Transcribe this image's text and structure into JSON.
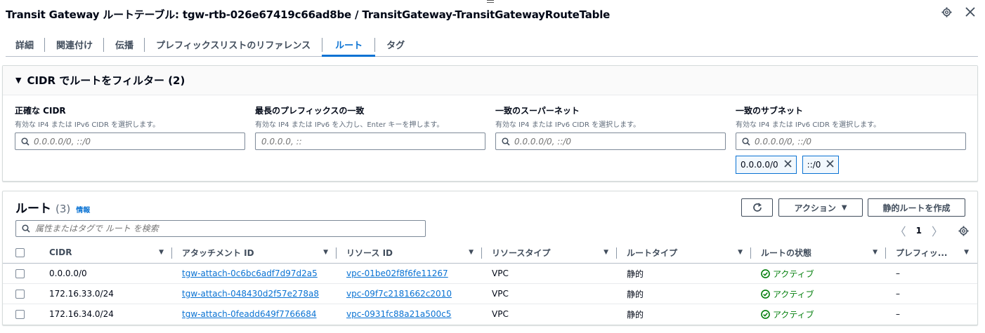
{
  "header": {
    "title": "Transit Gateway ルートテーブル: tgw-rtb-026e67419c66ad8be / TransitGateway-TransitGatewayRouteTable"
  },
  "tabs": [
    {
      "label": "詳細"
    },
    {
      "label": "関連付け"
    },
    {
      "label": "伝播"
    },
    {
      "label": "プレフィックスリストのリファレンス"
    },
    {
      "label": "ルート",
      "active": true
    },
    {
      "label": "タグ"
    }
  ],
  "filter": {
    "title": "CIDR でルートをフィルター (2)",
    "fields": [
      {
        "label": "正確な CIDR",
        "description": "有効な IP4 または IPv6 CIDR を選択します。",
        "placeholder": "0.0.0.0/0, ::/0",
        "search_icon": true
      },
      {
        "label": "最長のプレフィックスの一致",
        "description": "有効な IP4 または IPv6 を入力し、Enter キーを押します。",
        "placeholder": "0.0.0.0, ::",
        "search_icon": false
      },
      {
        "label": "一致のスーパーネット",
        "description": "有効な IP4 または IPv6 CIDR を選択します。",
        "placeholder": "0.0.0.0/0, ::/0",
        "search_icon": true
      },
      {
        "label": "一致のサブネット",
        "description": "有効な IP4 または IPv6 CIDR を選択します。",
        "placeholder": "0.0.0.0/0, ::/0",
        "search_icon": true
      }
    ],
    "tokens": [
      "0.0.0.0/0",
      "::/0"
    ]
  },
  "routes": {
    "title": "ルート",
    "count": "(3)",
    "info_link": "情報",
    "actions_label": "アクション",
    "create_label": "静的ルートを作成",
    "search_placeholder": "属性またはタグで ルート を検索",
    "page": "1",
    "columns": [
      "CIDR",
      "アタッチメント ID",
      "リソース ID",
      "リソースタイプ",
      "ルートタイプ",
      "ルートの状態",
      "プレフィッ..."
    ],
    "rows": [
      {
        "cidr": "0.0.0.0/0",
        "attachment": "tgw-attach-0c6bc6adf7d97d2a5",
        "resource": "vpc-01be02f8f6fe11267",
        "type": "VPC",
        "route_type": "静的",
        "state": "アクティブ",
        "prefix": "–"
      },
      {
        "cidr": "172.16.33.0/24",
        "attachment": "tgw-attach-048430d2f57e278a8",
        "resource": "vpc-09f7c2181662c2010",
        "type": "VPC",
        "route_type": "静的",
        "state": "アクティブ",
        "prefix": "–"
      },
      {
        "cidr": "172.16.34.0/24",
        "attachment": "tgw-attach-0feadd649f7766684",
        "resource": "vpc-0931fc88a21a500c5",
        "type": "VPC",
        "route_type": "静的",
        "state": "アクティブ",
        "prefix": "–"
      }
    ]
  },
  "colors": {
    "link": "#0972d3",
    "success": "#037f0c",
    "text": "#000716"
  }
}
